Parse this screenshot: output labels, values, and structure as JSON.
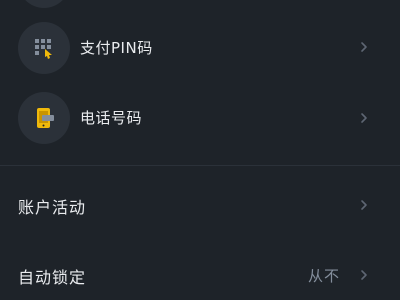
{
  "security_list": {
    "items": [
      {
        "label": "支付PIN码",
        "icon": "keypad-icon"
      },
      {
        "label": "电话号码",
        "icon": "phone-icon"
      }
    ]
  },
  "settings_list": {
    "items": [
      {
        "label": "账户活动",
        "value": ""
      },
      {
        "label": "自动锁定",
        "value": "从不"
      }
    ]
  },
  "colors": {
    "background": "#1e2329",
    "icon_circle": "#2b3139",
    "accent": "#f0b90b",
    "text": "#eaecef",
    "muted": "#848e9c"
  }
}
